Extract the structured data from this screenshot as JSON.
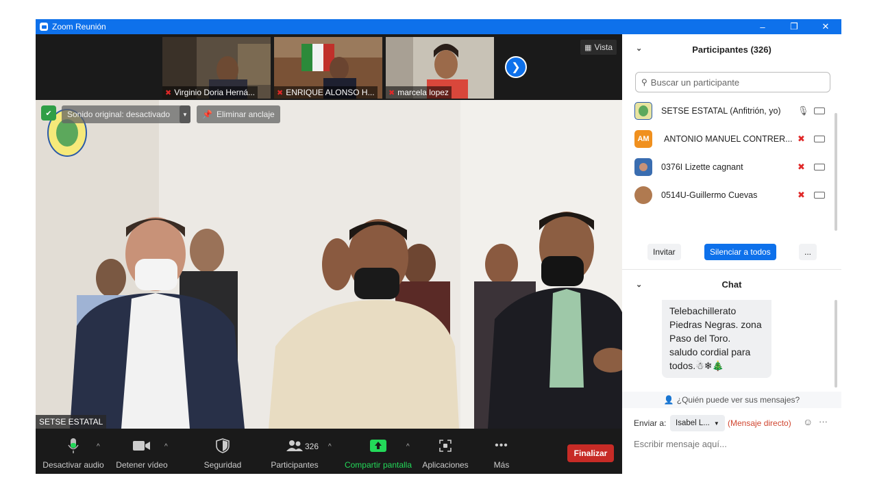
{
  "window": {
    "title": "Zoom Reunión",
    "controls": [
      "–",
      "❐",
      "✕"
    ]
  },
  "filmstrip": {
    "tiles": [
      {
        "name": "Virginio Doria Herná...",
        "muted": true,
        "bg": "#5a4e40"
      },
      {
        "name": "ENRIQUE ALONSO H...",
        "muted": true,
        "bg": "#7a5236"
      },
      {
        "name": "marcela lopez",
        "muted": true,
        "bg": "#b9b0a2"
      }
    ],
    "view_label": "Vista"
  },
  "main": {
    "original_sound": "Sonido original: desactivado",
    "unpin_label": "Eliminar anclaje",
    "speaker_name": "SETSE ESTATAL"
  },
  "toolbar": {
    "audio": "Desactivar audio",
    "video": "Detener vídeo",
    "security": "Seguridad",
    "participants": "Participantes",
    "participant_count": "326",
    "share": "Compartir pantalla",
    "apps": "Aplicaciones",
    "more": "Más",
    "end": "Finalizar",
    "share_color": "#23d959",
    "end_color": "#c72b26"
  },
  "participants_panel": {
    "title": "Participantes (326)",
    "search_placeholder": "Buscar un participante",
    "list": [
      {
        "name": "SETSE ESTATAL (Anfitrión, yo)",
        "avatar": "",
        "avatar_color": "#e8e4a0",
        "muted": false
      },
      {
        "name": "ANTONIO MANUEL CONTRER...",
        "avatar": "AM",
        "avatar_color": "#f0901e",
        "muted": true
      },
      {
        "name": "0376I Lizette cagnant",
        "avatar": "",
        "avatar_color": "#3a6db0",
        "muted": true
      },
      {
        "name": "0514U-Guillermo Cuevas",
        "avatar": "",
        "avatar_color": "#b07a50",
        "muted": true
      }
    ],
    "invite": "Invitar",
    "mute_all": "Silenciar a todos",
    "more": "..."
  },
  "chat": {
    "title": "Chat",
    "message_lines": [
      "Telebachillerato",
      "Piedras Negras. zona",
      "Paso del Toro.",
      "saludo cordial para",
      "todos.☃❄🎄"
    ],
    "who_can_see": "¿Quién puede ver sus mensajes?",
    "send_to_label": "Enviar a:",
    "recipient": "Isabel L...",
    "direct": "(Mensaje directo)",
    "compose_placeholder": "Escribir mensaje aquí..."
  }
}
